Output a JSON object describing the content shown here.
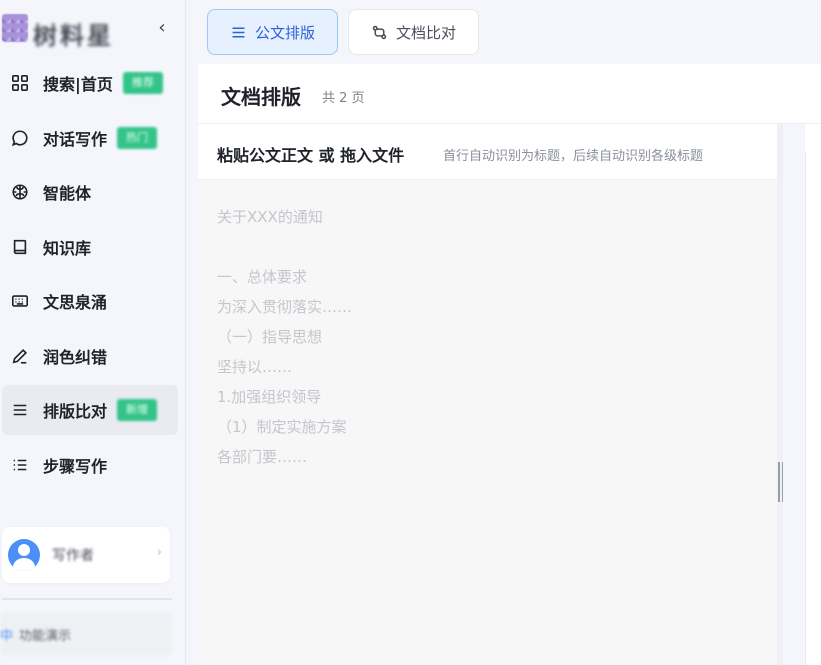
{
  "app": {
    "name": "树料星",
    "collapse_glyph": "‹"
  },
  "sidebar": {
    "items": [
      {
        "label": "搜索|首页",
        "icon": "grid-icon",
        "badge": "推荐"
      },
      {
        "label": "对话写作",
        "icon": "chat-bubble-icon",
        "badge": "热门"
      },
      {
        "label": "智能体",
        "icon": "brain-icon",
        "badge": ""
      },
      {
        "label": "知识库",
        "icon": "book-icon",
        "badge": ""
      },
      {
        "label": "文思泉涌",
        "icon": "keyboard-icon",
        "badge": ""
      },
      {
        "label": "润色纠错",
        "icon": "pen-icon",
        "badge": ""
      },
      {
        "label": "排版比对",
        "icon": "menu-lines-icon",
        "badge": "新增",
        "active": true
      },
      {
        "label": "步骤写作",
        "icon": "list-icon",
        "badge": ""
      }
    ],
    "user": {
      "name": "写作者",
      "chevron": "›"
    },
    "footer": {
      "lang": "中",
      "text": "功能演示"
    }
  },
  "tabs": [
    {
      "label": "公文排版",
      "icon": "menu-lines-icon",
      "active": true
    },
    {
      "label": "文档比对",
      "icon": "compare-icon",
      "active": false
    }
  ],
  "main": {
    "title": "文档排版",
    "page_count": "共 2 页",
    "editor": {
      "title": "粘贴公文正文 或 拖入文件",
      "hint": "首行自动识别为标题，后续自动识别各级标题",
      "placeholder": "关于XXX的通知\n\n一、总体要求\n为深入贯彻落实……\n（一）指导思想\n坚持以……\n1.加强组织领导\n（1）制定实施方案\n各部门要……"
    }
  },
  "colors": {
    "accent": "#2b63d9",
    "badge": "#34c48a",
    "active_tab_bg": "#e6f0fe"
  }
}
